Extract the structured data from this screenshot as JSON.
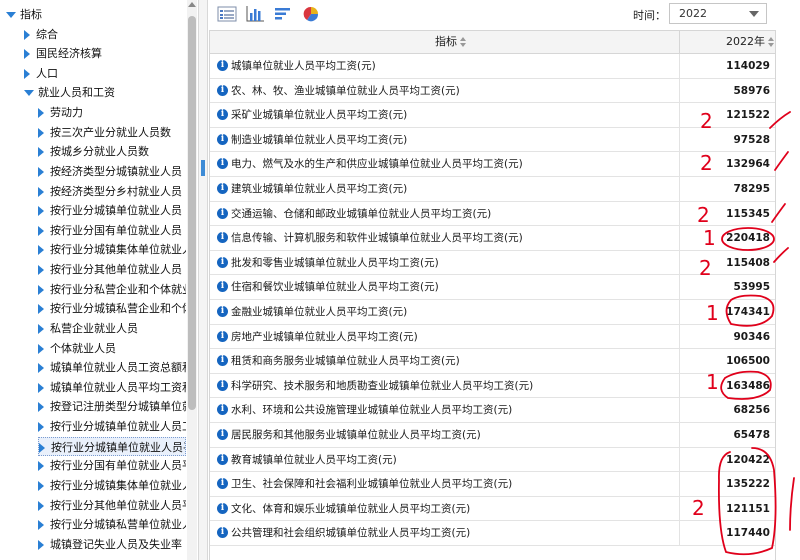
{
  "tree": {
    "items": [
      {
        "label": "指标",
        "level": 0,
        "expanded": true
      },
      {
        "label": "综合",
        "level": 1,
        "expanded": false
      },
      {
        "label": "国民经济核算",
        "level": 1,
        "expanded": false
      },
      {
        "label": "人口",
        "level": 1,
        "expanded": false
      },
      {
        "label": "就业人员和工资",
        "level": 1,
        "expanded": true
      },
      {
        "label": "劳动力",
        "level": 2,
        "expanded": false
      },
      {
        "label": "按三次产业分就业人员数",
        "level": 2,
        "expanded": false
      },
      {
        "label": "按城乡分就业人员数",
        "level": 2,
        "expanded": false
      },
      {
        "label": "按经济类型分城镇就业人员",
        "level": 2,
        "expanded": false
      },
      {
        "label": "按经济类型分乡村就业人员",
        "level": 2,
        "expanded": false
      },
      {
        "label": "按行业分城镇单位就业人员",
        "level": 2,
        "expanded": false
      },
      {
        "label": "按行业分国有单位就业人员",
        "level": 2,
        "expanded": false
      },
      {
        "label": "按行业分城镇集体单位就业人员",
        "level": 2,
        "expanded": false
      },
      {
        "label": "按行业分其他单位就业人员",
        "level": 2,
        "expanded": false
      },
      {
        "label": "按行业分私营企业和个体就业人",
        "level": 2,
        "expanded": false
      },
      {
        "label": "按行业分城镇私营企业和个体就",
        "level": 2,
        "expanded": false
      },
      {
        "label": "私营企业就业人员",
        "level": 2,
        "expanded": false
      },
      {
        "label": "个体就业人员",
        "level": 2,
        "expanded": false
      },
      {
        "label": "城镇单位就业人员工资总额和指",
        "level": 2,
        "expanded": false
      },
      {
        "label": "城镇单位就业人员平均工资和指",
        "level": 2,
        "expanded": false
      },
      {
        "label": "按登记注册类型分城镇单位就业",
        "level": 2,
        "expanded": false
      },
      {
        "label": "按行业分城镇单位就业人员工资",
        "level": 2,
        "expanded": false
      },
      {
        "label": "按行业分城镇单位就业人员平均",
        "level": 2,
        "expanded": false,
        "selected": true
      },
      {
        "label": "按行业分国有单位就业人员平均",
        "level": 2,
        "expanded": false
      },
      {
        "label": "按行业分城镇集体单位就业人员",
        "level": 2,
        "expanded": false
      },
      {
        "label": "按行业分其他单位就业人员平均",
        "level": 2,
        "expanded": false
      },
      {
        "label": "按行业分城镇私营单位就业人员",
        "level": 2,
        "expanded": false
      },
      {
        "label": "城镇登记失业人员及失业率",
        "level": 2,
        "expanded": false
      }
    ]
  },
  "toolbar": {
    "icons": [
      "table-view-icon",
      "bar-chart-icon",
      "horizontal-bar-icon",
      "pie-chart-icon"
    ],
    "time_label": "时间：",
    "year_value": "2022"
  },
  "table": {
    "headers": {
      "indicator": "指标",
      "year": "2022年"
    },
    "rows": [
      {
        "name": "城镇单位就业人员平均工资(元)",
        "value": "114029"
      },
      {
        "name": "农、林、牧、渔业城镇单位就业人员平均工资(元)",
        "value": "58976"
      },
      {
        "name": "采矿业城镇单位就业人员平均工资(元)",
        "value": "121522"
      },
      {
        "name": "制造业城镇单位就业人员平均工资(元)",
        "value": "97528"
      },
      {
        "name": "电力、燃气及水的生产和供应业城镇单位就业人员平均工资(元)",
        "value": "132964"
      },
      {
        "name": "建筑业城镇单位就业人员平均工资(元)",
        "value": "78295"
      },
      {
        "name": "交通运输、仓储和邮政业城镇单位就业人员平均工资(元)",
        "value": "115345"
      },
      {
        "name": "信息传输、计算机服务和软件业城镇单位就业人员平均工资(元)",
        "value": "220418"
      },
      {
        "name": "批发和零售业城镇单位就业人员平均工资(元)",
        "value": "115408"
      },
      {
        "name": "住宿和餐饮业城镇单位就业人员平均工资(元)",
        "value": "53995"
      },
      {
        "name": "金融业城镇单位就业人员平均工资(元)",
        "value": "174341"
      },
      {
        "name": "房地产业城镇单位就业人员平均工资(元)",
        "value": "90346"
      },
      {
        "name": "租赁和商务服务业城镇单位就业人员平均工资(元)",
        "value": "106500"
      },
      {
        "name": "科学研究、技术服务和地质勘查业城镇单位就业人员平均工资(元)",
        "value": "163486"
      },
      {
        "name": "水利、环境和公共设施管理业城镇单位就业人员平均工资(元)",
        "value": "68256"
      },
      {
        "name": "居民服务和其他服务业城镇单位就业人员平均工资(元)",
        "value": "65478"
      },
      {
        "name": "教育城镇单位就业人员平均工资(元)",
        "value": "120422"
      },
      {
        "name": "卫生、社会保障和社会福利业城镇单位就业人员平均工资(元)",
        "value": "135222"
      },
      {
        "name": "文化、体育和娱乐业城镇单位就业人员平均工资(元)",
        "value": "121151"
      },
      {
        "name": "公共管理和社会组织城镇单位就业人员平均工资(元)",
        "value": "117440"
      }
    ]
  },
  "annotations": {
    "color": "#e0001b",
    "marks": [
      "2",
      "2",
      "2",
      "1",
      "2",
      "1",
      "1",
      "2"
    ]
  }
}
